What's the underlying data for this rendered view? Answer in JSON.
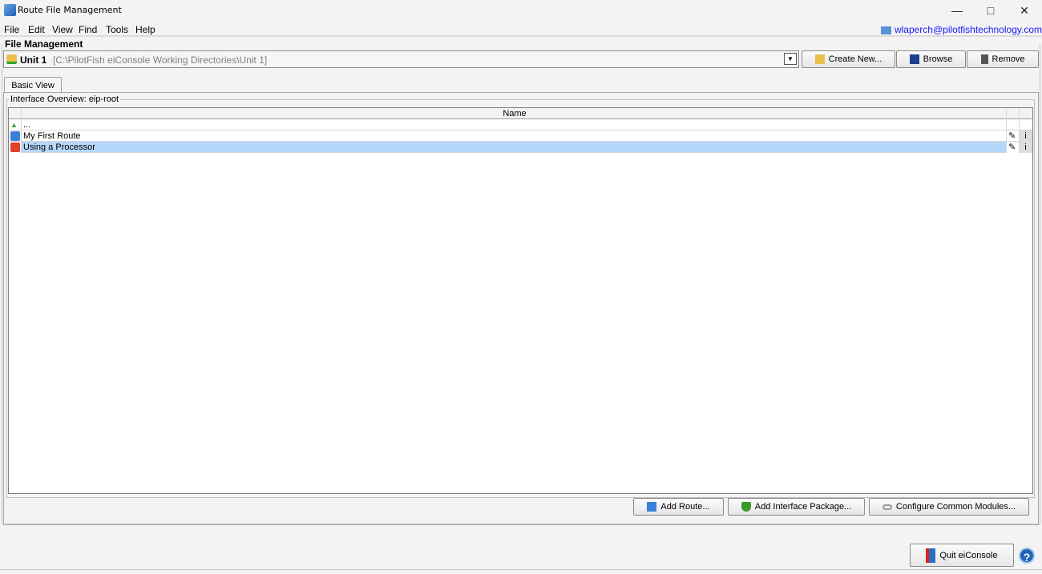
{
  "window": {
    "title": "Route File Management",
    "icon": "app-icon",
    "controls": [
      "minimize",
      "maximize",
      "close"
    ]
  },
  "menu": [
    {
      "label": "File"
    },
    {
      "label": "Edit"
    },
    {
      "label": "View"
    },
    {
      "label": "Find"
    },
    {
      "label": "Tools"
    },
    {
      "label": "Help"
    }
  ],
  "user": {
    "email": "wlaperch@pilotfishtechnology.com",
    "icon": "user-card-icon"
  },
  "file_management": {
    "label": "File Management",
    "unit": {
      "name": "Unit 1",
      "path": "[C:\\PilotFish eiConsole Working Directories\\Unit 1]"
    },
    "buttons": {
      "create": "Create New...",
      "browse": "Browse",
      "remove": "Remove"
    }
  },
  "tabs": [
    {
      "label": "Basic View",
      "active": true
    }
  ],
  "overview": {
    "title": "Interface Overview: eip-root",
    "columns": [
      "",
      "Name",
      "",
      ""
    ],
    "rows": [
      {
        "name": "...",
        "icon": "up-arrow-icon",
        "selected": false,
        "actions": false
      },
      {
        "name": "My First Route",
        "icon": "blue-puzzle-icon",
        "selected": false,
        "actions": true
      },
      {
        "name": "Using a Processor",
        "icon": "red-puzzle-icon",
        "selected": true,
        "actions": true
      }
    ],
    "buttons": {
      "add_route": "Add Route...",
      "add_package": "Add Interface Package...",
      "configure": "Configure Common Modules..."
    }
  },
  "footer": {
    "quit": "Quit eiConsole",
    "help_icon": "help-icon"
  },
  "colors": {
    "selection": "#b5d7fa",
    "link": "#1a1aff"
  }
}
